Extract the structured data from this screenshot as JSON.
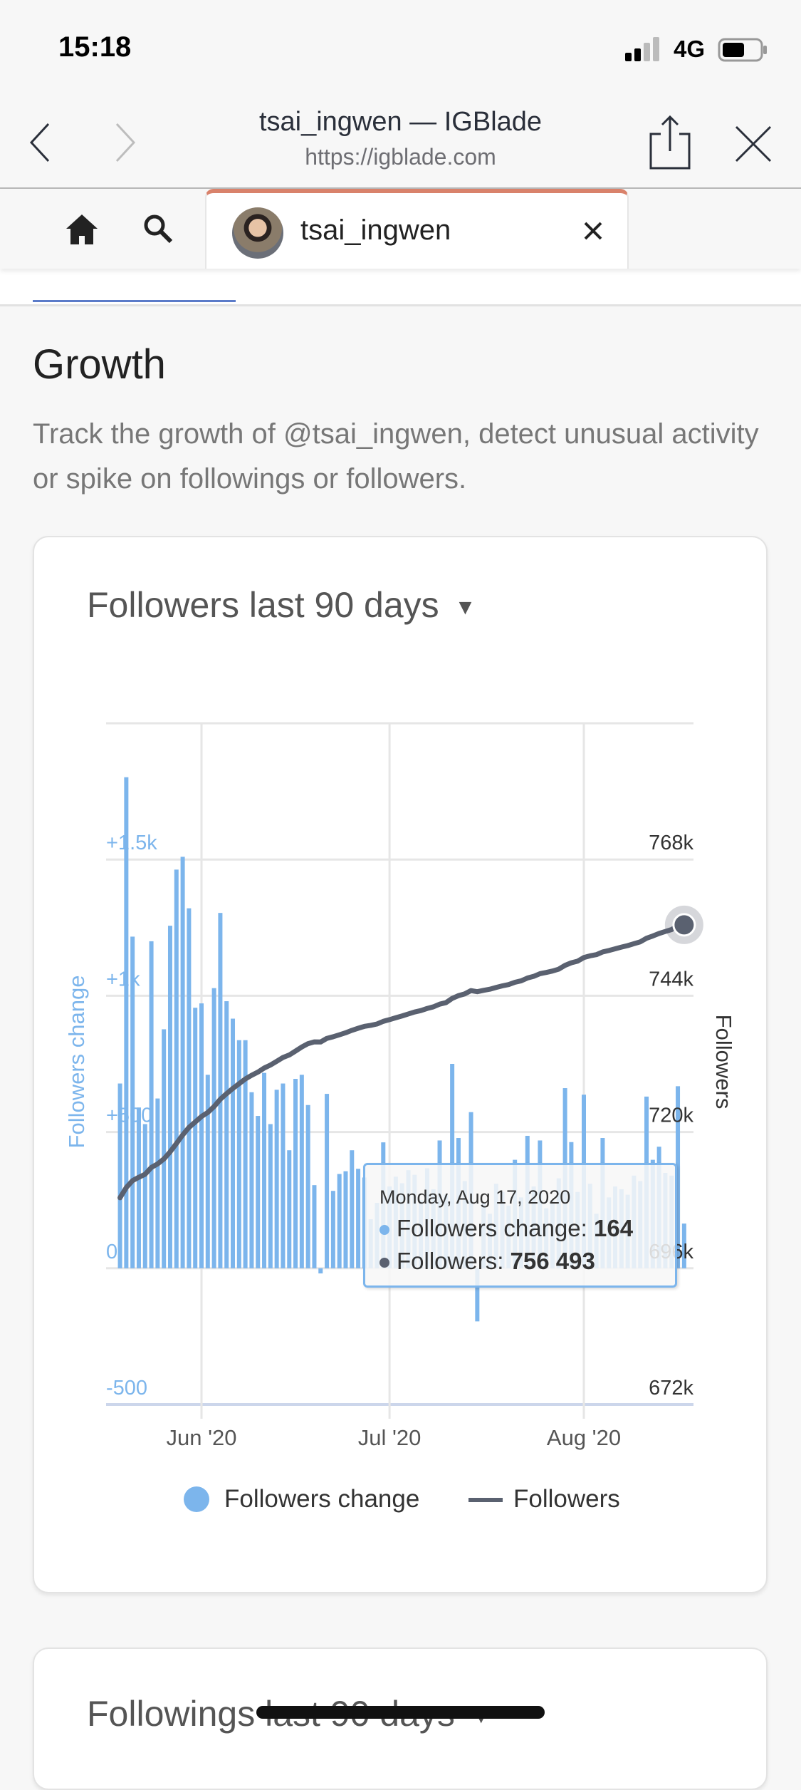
{
  "status_bar": {
    "time": "15:18",
    "network": "4G",
    "battery_level": 0.6
  },
  "browser": {
    "title": "tsai_ingwen — IGBlade",
    "url": "https://igblade.com"
  },
  "tabs": {
    "active_label": "tsai_ingwen",
    "accent": "#d9826b"
  },
  "section": {
    "title": "Growth",
    "description": "Track the growth of @tsai_ingwen, detect unusual activity or spike on followings or followers."
  },
  "followers_card": {
    "title": "Followers last 90 days"
  },
  "followings_card": {
    "title": "Followings last 90 days"
  },
  "tooltip": {
    "date": "Monday, Aug 17, 2020",
    "change_label": "Followers change: ",
    "change_value": "164",
    "followers_label": "Followers: ",
    "followers_value": "756 493"
  },
  "chart_data": {
    "type": "bar+line",
    "xlabel": "",
    "x_tick_labels": [
      "Jun '20",
      "Jul '20",
      "Aug '20"
    ],
    "y_left": {
      "label": "Followers change",
      "tick_labels": [
        "-500",
        "0",
        "+500",
        "+1k",
        "+1.5k"
      ],
      "ylim": [
        -500,
        2000
      ],
      "color": "#7cb5ec"
    },
    "y_right": {
      "label": "Followers",
      "tick_labels": [
        "672k",
        "696k",
        "720k",
        "744k",
        "768k"
      ],
      "ylim": [
        672000,
        792000
      ]
    },
    "grid": true,
    "legend": "bottom",
    "x": [
      "2020-05-19",
      "2020-05-20",
      "2020-05-21",
      "2020-05-22",
      "2020-05-23",
      "2020-05-24",
      "2020-05-25",
      "2020-05-26",
      "2020-05-27",
      "2020-05-28",
      "2020-05-29",
      "2020-05-30",
      "2020-05-31",
      "2020-06-01",
      "2020-06-02",
      "2020-06-03",
      "2020-06-04",
      "2020-06-05",
      "2020-06-06",
      "2020-06-07",
      "2020-06-08",
      "2020-06-09",
      "2020-06-10",
      "2020-06-11",
      "2020-06-12",
      "2020-06-13",
      "2020-06-14",
      "2020-06-15",
      "2020-06-16",
      "2020-06-17",
      "2020-06-18",
      "2020-06-19",
      "2020-06-20",
      "2020-06-21",
      "2020-06-22",
      "2020-06-23",
      "2020-06-24",
      "2020-06-25",
      "2020-06-26",
      "2020-06-27",
      "2020-06-28",
      "2020-06-29",
      "2020-06-30",
      "2020-07-01",
      "2020-07-02",
      "2020-07-03",
      "2020-07-04",
      "2020-07-05",
      "2020-07-06",
      "2020-07-07",
      "2020-07-08",
      "2020-07-09",
      "2020-07-10",
      "2020-07-11",
      "2020-07-12",
      "2020-07-13",
      "2020-07-14",
      "2020-07-15",
      "2020-07-16",
      "2020-07-17",
      "2020-07-18",
      "2020-07-19",
      "2020-07-20",
      "2020-07-21",
      "2020-07-22",
      "2020-07-23",
      "2020-07-24",
      "2020-07-25",
      "2020-07-26",
      "2020-07-27",
      "2020-07-28",
      "2020-07-29",
      "2020-07-30",
      "2020-07-31",
      "2020-08-01",
      "2020-08-02",
      "2020-08-03",
      "2020-08-04",
      "2020-08-05",
      "2020-08-06",
      "2020-08-07",
      "2020-08-08",
      "2020-08-09",
      "2020-08-10",
      "2020-08-11",
      "2020-08-12",
      "2020-08-13",
      "2020-08-14",
      "2020-08-15",
      "2020-08-16",
      "2020-08-17"
    ],
    "series": [
      {
        "name": "Followers change",
        "type": "bar",
        "color": "#7cb5ec",
        "axis": "left",
        "values": [
          678,
          1802,
          1217,
          590,
          529,
          1200,
          623,
          877,
          1257,
          1463,
          1510,
          1321,
          956,
          972,
          710,
          1028,
          1304,
          980,
          916,
          837,
          837,
          646,
          559,
          717,
          529,
          655,
          678,
          433,
          695,
          710,
          599,
          305,
          -19,
          640,
          284,
          346,
          356,
          433,
          365,
          333,
          180,
          240,
          462,
          300,
          336,
          312,
          360,
          343,
          250,
          367,
          290,
          469,
          270,
          750,
          478,
          320,
          573,
          -195,
          240,
          200,
          310,
          280,
          230,
          398,
          260,
          486,
          300,
          469,
          220,
          250,
          330,
          661,
          463,
          280,
          637,
          310,
          200,
          478,
          260,
          300,
          290,
          270,
          340,
          320,
          630,
          398,
          446,
          350,
          340,
          668,
          164
        ]
      },
      {
        "name": "Followers",
        "type": "line",
        "color": "#5a6170",
        "axis": "right",
        "values": [
          708417,
          710219,
          711436,
          712026,
          712555,
          713755,
          714378,
          715255,
          716512,
          717975,
          719485,
          720806,
          721762,
          722734,
          723444,
          724472,
          725776,
          726756,
          727672,
          728509,
          729346,
          729992,
          730551,
          731268,
          731797,
          732452,
          733130,
          733563,
          734258,
          734968,
          735567,
          735872,
          735853,
          736493,
          736777,
          737123,
          737479,
          737912,
          738277,
          738610,
          738790,
          739030,
          739492,
          739792,
          740128,
          740440,
          740800,
          741143,
          741393,
          741760,
          742050,
          742519,
          742789,
          743539,
          744017,
          744337,
          744910,
          744715,
          744955,
          745155,
          745465,
          745745,
          745975,
          746373,
          746633,
          747119,
          747419,
          747888,
          748108,
          748358,
          748688,
          749349,
          749812,
          750092,
          750729,
          751039,
          751239,
          751717,
          751977,
          752277,
          752567,
          752837,
          753177,
          753497,
          754127,
          754525,
          754971,
          755321,
          755661,
          756329,
          756493
        ]
      }
    ]
  }
}
